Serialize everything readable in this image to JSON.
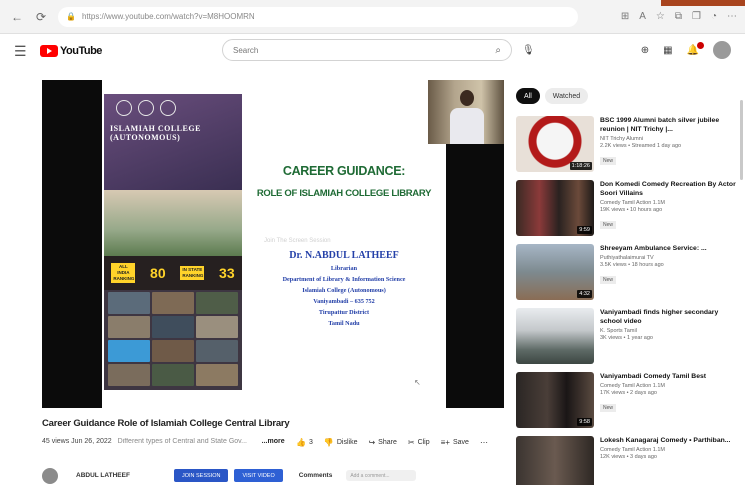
{
  "browser": {
    "url": "https://www.youtube.com/watch?v=M8HOOMRN",
    "accent_color": "#a8441e"
  },
  "header": {
    "logo_text": "YouTube",
    "search_placeholder": "Search"
  },
  "player": {
    "poster": {
      "title": "ISLAMIAH COLLEGE (AUTONOMOUS)",
      "stat1_label": "ALL INDIA RANKING",
      "stat1_value": "80",
      "stat2_label": "IN STATE RANKING",
      "stat2_value": "33"
    },
    "slide": {
      "title": "CAREER GUIDANCE:",
      "subtitle": "ROLE OF ISLAMIAH COLLEGE  LIBRARY",
      "watermark": "Join The Screen Session",
      "presenter_name": "Dr. N.ABDUL LATHEEF",
      "lines": [
        "Librarian",
        "Department of Library & Information Science",
        "Islamiah College (Autonomous)",
        "Vaniyambadi – 635 752",
        "Tirupattur District",
        "Tamil Nadu"
      ]
    }
  },
  "video": {
    "title": "Career Guidance Role of Islamiah College Central Library",
    "views_date": "45 views  Jun 26, 2022",
    "description": "Different types of Central and State Gov...",
    "more": "...more",
    "likes": "3",
    "dislike": "Dislike",
    "share": "Share",
    "clip": "Clip",
    "save": "Save"
  },
  "channel": {
    "name": "ABDUL LATHEEF",
    "btn_a": "JOIN SESSION",
    "btn_b": "VISIT VIDEO",
    "comments": "Comments",
    "comment_placeholder": "Add a comment..."
  },
  "sidebar": {
    "chips": [
      "All",
      "Watched"
    ],
    "items": [
      {
        "title": "BSC 1999 Alumni batch silver jubilee reunion | NIT Trichy |...",
        "channel": "NIT Trichy Alumni",
        "stats": "2.2K views • Streamed 1 day ago",
        "badge": "New",
        "duration": "1:18:26"
      },
      {
        "title": "Don Komedi Comedy Recreation By Actor Soori Villains",
        "channel": "Comedy Tamil Action 1.1M",
        "stats": "19K views • 10 hours ago",
        "badge": "New",
        "duration": "9:59"
      },
      {
        "title": "Shreeyam Ambulance Service: ...",
        "channel": "Puthiyathalaimurai TV",
        "stats": "3.5K views • 18 hours ago",
        "badge": "New",
        "duration": "4:32"
      },
      {
        "title": "Vaniyambadi finds higher secondary school video",
        "channel": "K. Sports Tamil",
        "stats": "3K views • 1 year ago",
        "badge": "",
        "duration": ""
      },
      {
        "title": "Vaniyambadi Comedy Tamil Best",
        "channel": "Comedy Tamil Action 1.1M",
        "stats": "17K views • 2 days ago",
        "badge": "New",
        "duration": "9:58"
      },
      {
        "title": "Lokesh Kanagaraj Comedy • Parthiban...",
        "channel": "Comedy Tamil Action 1.1M",
        "stats": "12K views • 3 days ago",
        "badge": "",
        "duration": ""
      }
    ]
  },
  "colors": {
    "youtube_red": "#ff0000",
    "slide_green": "#1f6b35",
    "slide_blue": "#2440a8",
    "stat_yellow": "#ffd32a"
  }
}
